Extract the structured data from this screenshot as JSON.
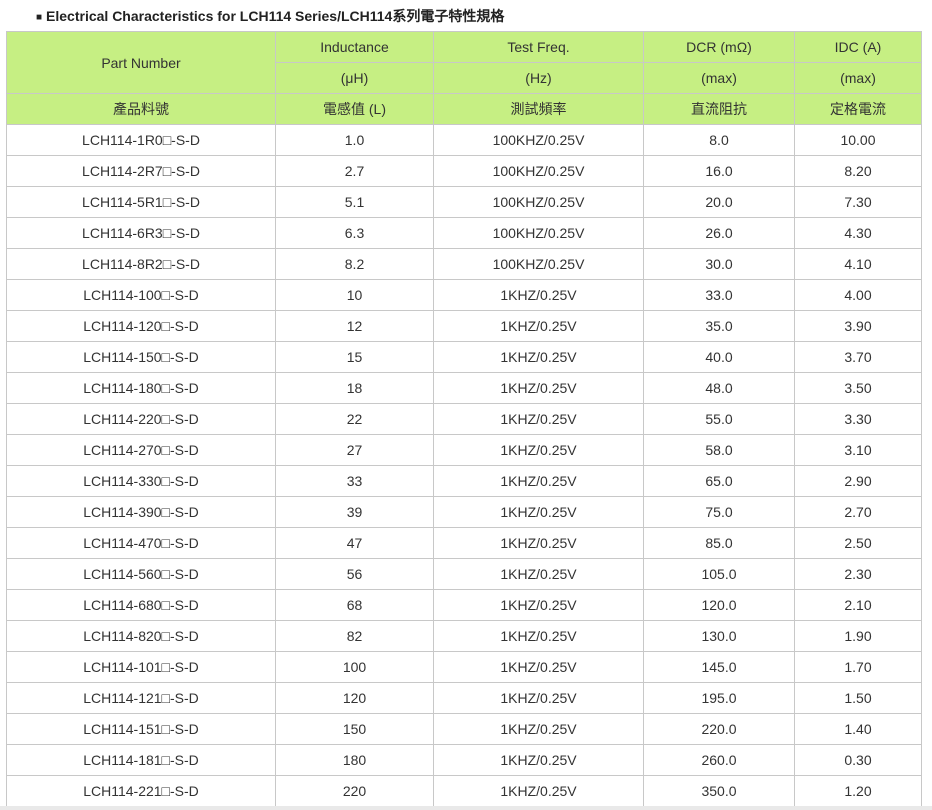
{
  "title": "Electrical Characteristics for LCH114 Series/LCH114系列電子特性規格",
  "title_bullet": "■",
  "colors": {
    "header_bg": "#c6ef83",
    "border": "#c8c8c8",
    "text": "#333333"
  },
  "header": {
    "part_number": "Part Number",
    "inductance": "Inductance",
    "inductance_unit": "(μH)",
    "test_freq": "Test Freq.",
    "test_freq_unit": "(Hz)",
    "dcr": "DCR (mΩ)",
    "dcr_unit": "(max)",
    "idc": "IDC (A)",
    "idc_unit": "(max)",
    "part_number_zh": "產品料號",
    "inductance_zh": "電感值 (L)",
    "test_freq_zh": "測試頻率",
    "dcr_zh": "直流阻抗",
    "idc_zh": "定格電流"
  },
  "rows": [
    {
      "part": "LCH114-1R0□-S-D",
      "l": "1.0",
      "freq": "100KHZ/0.25V",
      "dcr": "8.0",
      "idc": "10.00"
    },
    {
      "part": "LCH114-2R7□-S-D",
      "l": "2.7",
      "freq": "100KHZ/0.25V",
      "dcr": "16.0",
      "idc": "8.20"
    },
    {
      "part": "LCH114-5R1□-S-D",
      "l": "5.1",
      "freq": "100KHZ/0.25V",
      "dcr": "20.0",
      "idc": "7.30"
    },
    {
      "part": "LCH114-6R3□-S-D",
      "l": "6.3",
      "freq": "100KHZ/0.25V",
      "dcr": "26.0",
      "idc": "4.30"
    },
    {
      "part": "LCH114-8R2□-S-D",
      "l": "8.2",
      "freq": "100KHZ/0.25V",
      "dcr": "30.0",
      "idc": "4.10"
    },
    {
      "part": "LCH114-100□-S-D",
      "l": "10",
      "freq": "1KHZ/0.25V",
      "dcr": "33.0",
      "idc": "4.00"
    },
    {
      "part": "LCH114-120□-S-D",
      "l": "12",
      "freq": "1KHZ/0.25V",
      "dcr": "35.0",
      "idc": "3.90"
    },
    {
      "part": "LCH114-150□-S-D",
      "l": "15",
      "freq": "1KHZ/0.25V",
      "dcr": "40.0",
      "idc": "3.70"
    },
    {
      "part": "LCH114-180□-S-D",
      "l": "18",
      "freq": "1KHZ/0.25V",
      "dcr": "48.0",
      "idc": "3.50"
    },
    {
      "part": "LCH114-220□-S-D",
      "l": "22",
      "freq": "1KHZ/0.25V",
      "dcr": "55.0",
      "idc": "3.30"
    },
    {
      "part": "LCH114-270□-S-D",
      "l": "27",
      "freq": "1KHZ/0.25V",
      "dcr": "58.0",
      "idc": "3.10"
    },
    {
      "part": "LCH114-330□-S-D",
      "l": "33",
      "freq": "1KHZ/0.25V",
      "dcr": "65.0",
      "idc": "2.90"
    },
    {
      "part": "LCH114-390□-S-D",
      "l": "39",
      "freq": "1KHZ/0.25V",
      "dcr": "75.0",
      "idc": "2.70"
    },
    {
      "part": "LCH114-470□-S-D",
      "l": "47",
      "freq": "1KHZ/0.25V",
      "dcr": "85.0",
      "idc": "2.50"
    },
    {
      "part": "LCH114-560□-S-D",
      "l": "56",
      "freq": "1KHZ/0.25V",
      "dcr": "105.0",
      "idc": "2.30"
    },
    {
      "part": "LCH114-680□-S-D",
      "l": "68",
      "freq": "1KHZ/0.25V",
      "dcr": "120.0",
      "idc": "2.10"
    },
    {
      "part": "LCH114-820□-S-D",
      "l": "82",
      "freq": "1KHZ/0.25V",
      "dcr": "130.0",
      "idc": "1.90"
    },
    {
      "part": "LCH114-101□-S-D",
      "l": "100",
      "freq": "1KHZ/0.25V",
      "dcr": "145.0",
      "idc": "1.70"
    },
    {
      "part": "LCH114-121□-S-D",
      "l": "120",
      "freq": "1KHZ/0.25V",
      "dcr": "195.0",
      "idc": "1.50"
    },
    {
      "part": "LCH114-151□-S-D",
      "l": "150",
      "freq": "1KHZ/0.25V",
      "dcr": "220.0",
      "idc": "1.40"
    },
    {
      "part": "LCH114-181□-S-D",
      "l": "180",
      "freq": "1KHZ/0.25V",
      "dcr": "260.0",
      "idc": "0.30"
    },
    {
      "part": "LCH114-221□-S-D",
      "l": "220",
      "freq": "1KHZ/0.25V",
      "dcr": "350.0",
      "idc": "1.20"
    }
  ]
}
